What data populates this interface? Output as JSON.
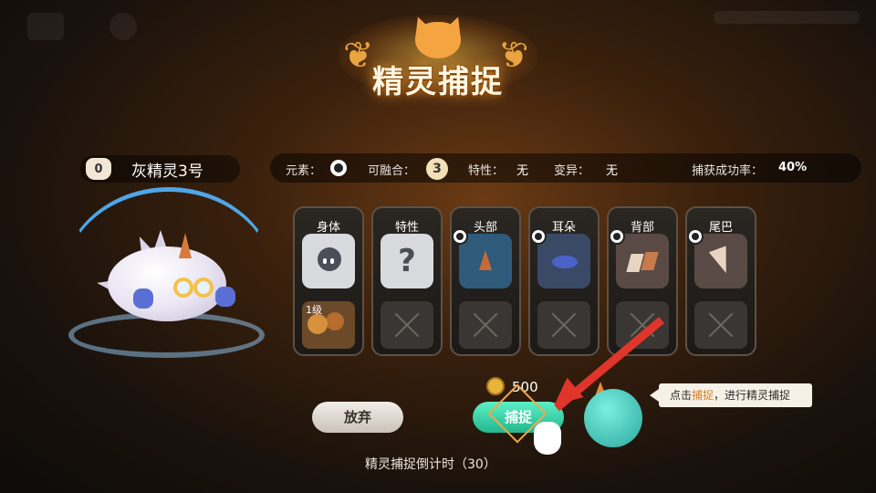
{
  "title": "精灵捕捉",
  "creature": {
    "level_badge": "0",
    "name": "灰精灵3号"
  },
  "info": {
    "element_label": "元素：",
    "fuse_label": "可融合：",
    "fuse_value": "3",
    "trait_label": "特性：",
    "trait_value": "无",
    "mutation_label": "变异：",
    "mutation_value": "无",
    "rate_label": "捕获成功率：",
    "rate_value": "40%"
  },
  "parts": [
    {
      "label": "身体",
      "top": "body",
      "bottom_level": "1级"
    },
    {
      "label": "特性",
      "top": "question"
    },
    {
      "label": "头部",
      "top": "part",
      "color": "#2f5a7a"
    },
    {
      "label": "耳朵",
      "top": "part",
      "color": "#3a4a66"
    },
    {
      "label": "背部",
      "top": "part",
      "color": "#5a4a46"
    },
    {
      "label": "尾巴",
      "top": "part",
      "color": "#5a4a46"
    }
  ],
  "cost": "500",
  "buttons": {
    "giveup": "放弃",
    "capture": "捕捉"
  },
  "countdown": "精灵捕捉倒计时（30）",
  "tip": {
    "prefix": "点击",
    "highlight": "捕捉",
    "suffix": "，进行精灵捕捉"
  },
  "colors": {
    "accent_green": "#3fd8aa",
    "arrow_red": "#e0352a",
    "tip_orange": "#d97a1a"
  }
}
